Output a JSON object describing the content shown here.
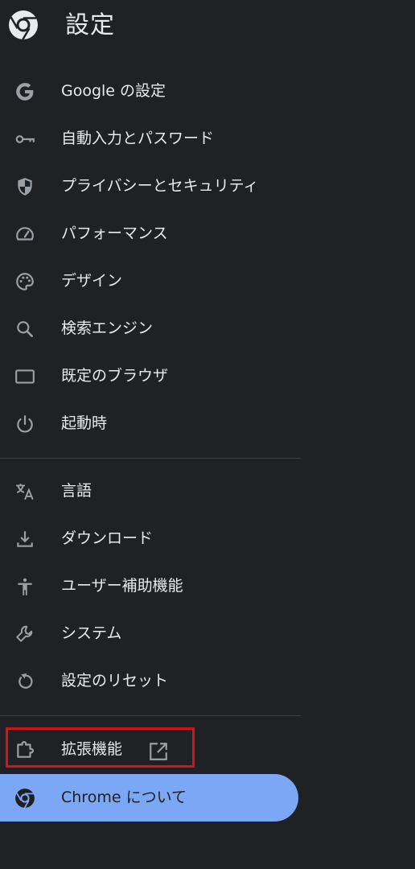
{
  "app": {
    "title": "設定"
  },
  "nav": {
    "group1": [
      {
        "label": "Google の設定",
        "icon": "google-g-icon"
      },
      {
        "label": "自動入力とパスワード",
        "icon": "key-icon"
      },
      {
        "label": "プライバシーとセキュリティ",
        "icon": "shield-icon"
      },
      {
        "label": "パフォーマンス",
        "icon": "speedometer-icon"
      },
      {
        "label": "デザイン",
        "icon": "palette-icon"
      },
      {
        "label": "検索エンジン",
        "icon": "search-icon"
      },
      {
        "label": "既定のブラウザ",
        "icon": "browser-window-icon"
      },
      {
        "label": "起動時",
        "icon": "power-icon"
      }
    ],
    "group2": [
      {
        "label": "言語",
        "icon": "translate-icon"
      },
      {
        "label": "ダウンロード",
        "icon": "download-icon"
      },
      {
        "label": "ユーザー補助機能",
        "icon": "accessibility-icon"
      },
      {
        "label": "システム",
        "icon": "wrench-icon"
      },
      {
        "label": "設定のリセット",
        "icon": "reset-icon"
      }
    ],
    "extensions": {
      "label": "拡張機能",
      "icon": "puzzle-icon",
      "link_icon": "open-in-new-icon"
    },
    "about": {
      "label": "Chrome について",
      "icon": "chrome-icon"
    }
  },
  "colors": {
    "background": "#202124",
    "text": "#e8eaed",
    "icon": "#9aa0a6",
    "active_bg": "#7ba7f4",
    "highlight_border": "#d3131b",
    "divider": "#3c4043"
  }
}
